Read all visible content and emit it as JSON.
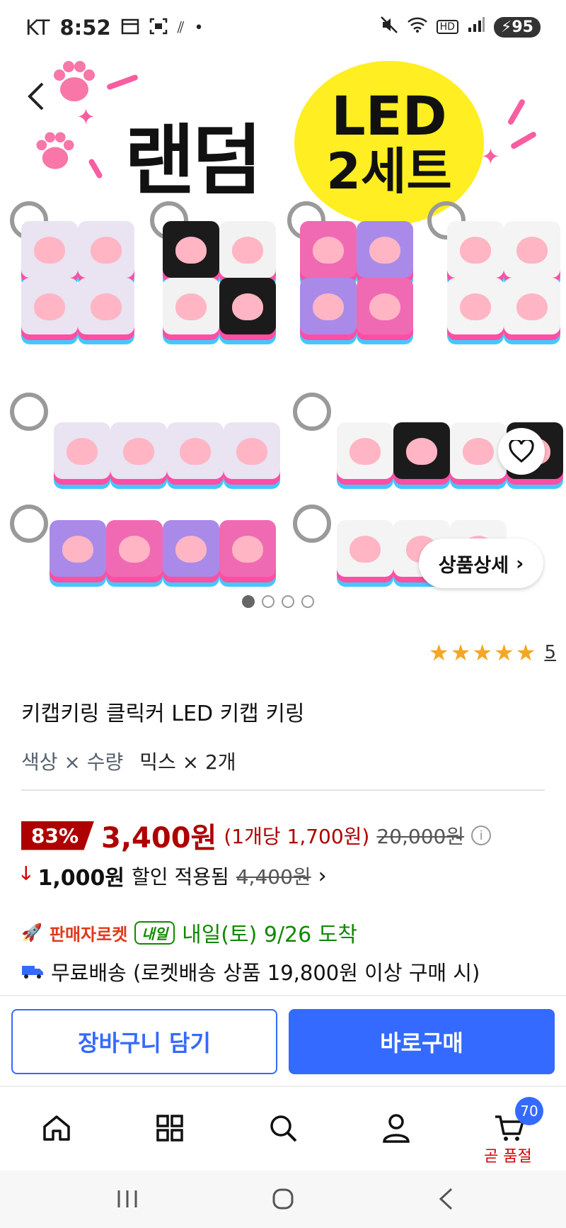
{
  "status_bar": {
    "carrier": "KT",
    "time": "8:52",
    "battery": "95",
    "network": "HD"
  },
  "hero": {
    "title": "랜덤",
    "badge_line1": "LED",
    "badge_line2": "2세트",
    "detail_button": "상품상세",
    "carousel_total": 4,
    "carousel_active": 1
  },
  "product": {
    "rating_stars": 5,
    "rating_count": "5",
    "title": "키캡키링 클릭커 LED 키캡 키링",
    "option_key": "색상 × 수량",
    "option_value": "믹스 × 2개"
  },
  "price": {
    "discount": "83%",
    "price": "3,400원",
    "unit_price": "(1개당 1,700원)",
    "original": "20,000원"
  },
  "coupon": {
    "amount": "1,000원",
    "label": "할인 적용됨",
    "before": "4,400원"
  },
  "delivery": {
    "rocket_label": "판매자로켓",
    "tag": "내일",
    "arrival": "내일(토) 9/26 도착",
    "shipping": "무료배송 (로켓배송 상품 19,800원 이상 구매 시)"
  },
  "buttons": {
    "cart": "장바구니 담기",
    "buy": "바로구매"
  },
  "bottom_nav": {
    "cart_count": "70",
    "soldout_label": "곧 품절"
  },
  "colors": {
    "accent_blue": "#346aff",
    "price_red": "#ae0000",
    "delivery_green": "#118800",
    "star": "#f5a623"
  }
}
